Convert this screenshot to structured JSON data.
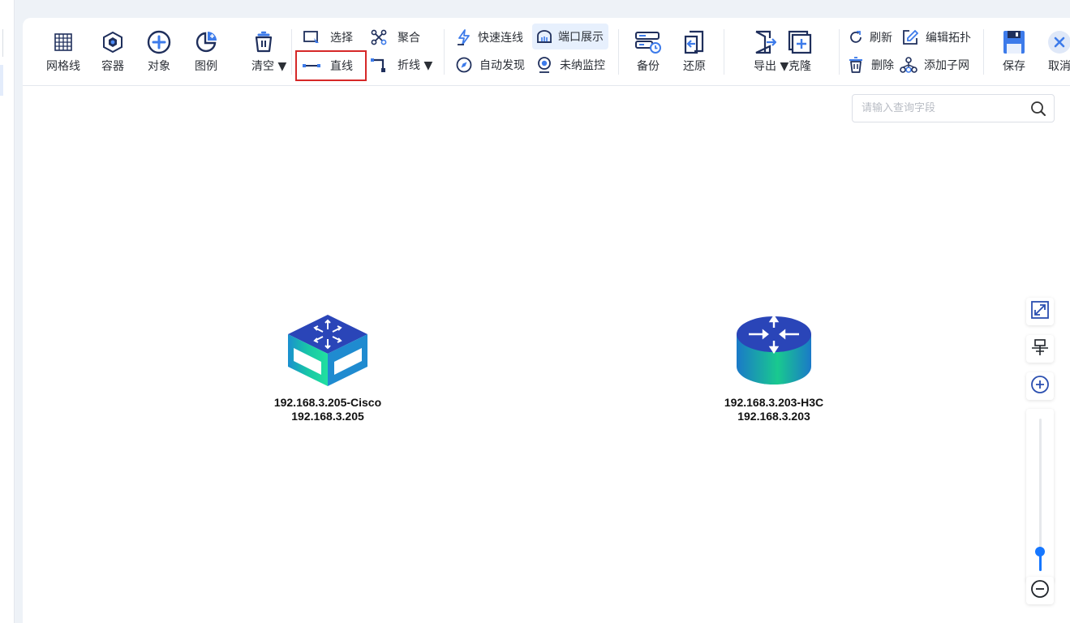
{
  "toolbar": {
    "grid": "网格线",
    "container": "容器",
    "object": "对象",
    "legend": "图例",
    "clear": "清空 ▼",
    "select": "选择",
    "aggregate": "聚合",
    "straight_line": "直线",
    "polyline": "折线 ▼",
    "quick_connect": "快速连线",
    "port_display": "端口展示",
    "auto_discover": "自动发现",
    "unmanaged_monitor": "未纳监控",
    "backup": "备份",
    "restore": "还原",
    "export": "导出 ▼",
    "clone": "克隆",
    "refresh": "刷新",
    "edit_topology": "编辑拓扑",
    "delete": "删除",
    "add_subnet": "添加子网",
    "save": "保存",
    "cancel": "取消"
  },
  "search": {
    "placeholder": "请输入查询字段"
  },
  "nodes": [
    {
      "name": "192.168.3.205-Cisco",
      "ip": "192.168.3.205",
      "type": "switch-icon"
    },
    {
      "name": "192.168.3.203-H3C",
      "ip": "192.168.3.203",
      "type": "router-icon"
    }
  ],
  "zoom": {
    "level": 0.87
  },
  "colors": {
    "accent": "#1677ff",
    "selected_outline": "#d62828",
    "icon_blue": "#2b4fb0",
    "icon_teal": "#16c9a0"
  }
}
